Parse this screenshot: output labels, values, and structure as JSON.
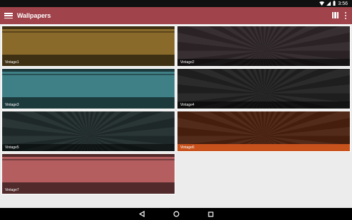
{
  "status_bar": {
    "time": "3:56"
  },
  "app_bar": {
    "title": "Wallpapers",
    "color": "#a0434b"
  },
  "wallpapers": [
    {
      "label": "Vintage1",
      "color": "#8a6a2a",
      "style": "stripe"
    },
    {
      "label": "Vintage2",
      "color": "#2c2426",
      "style": "sunburst"
    },
    {
      "label": "Vintage3",
      "color": "#3f7f86",
      "style": "stripe"
    },
    {
      "label": "Vintage4",
      "color": "#202020",
      "style": "sunburst"
    },
    {
      "label": "Vintage5",
      "color": "#1f2a2a",
      "style": "sunburst"
    },
    {
      "label": "Vintage6",
      "color": "#4a200f",
      "style": "sunburst"
    },
    {
      "label": "Vintage7",
      "color": "#b45e60",
      "style": "stripe"
    }
  ],
  "caption_highlight": {
    "index": 5,
    "color": "#c7521c"
  }
}
